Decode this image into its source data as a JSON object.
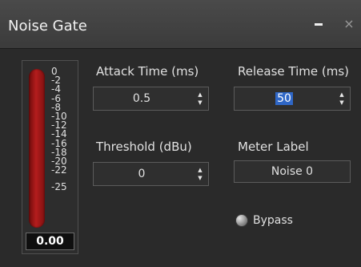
{
  "window": {
    "title": "Noise Gate",
    "minimize_icon": "minimize-icon",
    "close_icon": "close-icon",
    "close_glyph": "×"
  },
  "meter": {
    "scale": [
      "0",
      "-2",
      "-4",
      "-6",
      "-8",
      "-10",
      "-12",
      "-14",
      "-16",
      "-18",
      "-20",
      "-22",
      "-25"
    ],
    "value": "0.00",
    "fill_color": "#b41d1d"
  },
  "controls": {
    "attack": {
      "label": "Attack Time (ms)",
      "value": "0.5"
    },
    "release": {
      "label": "Release Time (ms)",
      "value": "50"
    },
    "threshold": {
      "label": "Threshold (dBu)",
      "value": "0"
    },
    "meter_label": {
      "label": "Meter Label",
      "value": "Noise 0"
    },
    "bypass": {
      "label": "Bypass"
    }
  },
  "colors": {
    "background": "#2b2b2b",
    "selection": "#2f67c7"
  }
}
